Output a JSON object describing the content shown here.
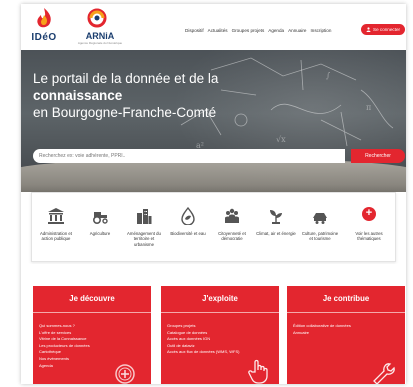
{
  "header": {
    "logo_ideo": "IDéO",
    "logo_arnia": "ARNiA",
    "logo_arnia_sub": "Agence Régionale du Numérique",
    "nav": [
      "Dispositif",
      "Actualités",
      "Groupes projets",
      "Agenda",
      "Annuaire",
      "Inscription"
    ],
    "connect_label": "Se connecter"
  },
  "hero": {
    "title_line1": "Le portail de la donnée et de la",
    "title_line2": "connaissance",
    "title_line3": "en Bourgogne-Franche-Comté"
  },
  "search": {
    "placeholder": "Recherchez ex: voie adhérente, PPRI..",
    "button_label": "Rechercher"
  },
  "themes": [
    {
      "icon": "institution-icon",
      "label": "Administration et action publique"
    },
    {
      "icon": "tractor-icon",
      "label": "Agriculture"
    },
    {
      "icon": "city-icon",
      "label": "Aménagement du territoire et urbanisme"
    },
    {
      "icon": "water-leaf-icon",
      "label": "Biodiversité et eau"
    },
    {
      "icon": "citizens-icon",
      "label": "Citoyenneté et démocratie"
    },
    {
      "icon": "plant-icon",
      "label": "Climat, air et énergie"
    },
    {
      "icon": "heritage-icon",
      "label": "Culture, patrimoine et tourisme"
    },
    {
      "icon": "plus-icon",
      "label": "Voir les autres thématiques"
    }
  ],
  "cards": {
    "discover": {
      "title": "Je découvre",
      "items": [
        "Qui sommes-nous ?",
        "L'offre de services",
        "Vitrine de la Connaissance",
        "Les producteurs de données",
        "Cartothèque",
        "Nos évènements",
        "Agenda"
      ]
    },
    "exploit": {
      "title": "J'exploite",
      "items": [
        "Groupes projets",
        "Catalogue de données",
        "Accès aux données IGN",
        "Outil de dataviz",
        "Accès aux flux de données (WMS, WFS)"
      ]
    },
    "contribute": {
      "title": "Je contribue",
      "items": [
        "Édition collaborative de données",
        "Annuaire"
      ]
    }
  },
  "colors": {
    "accent": "#e3262f",
    "brand_navy": "#1a3d6e"
  }
}
